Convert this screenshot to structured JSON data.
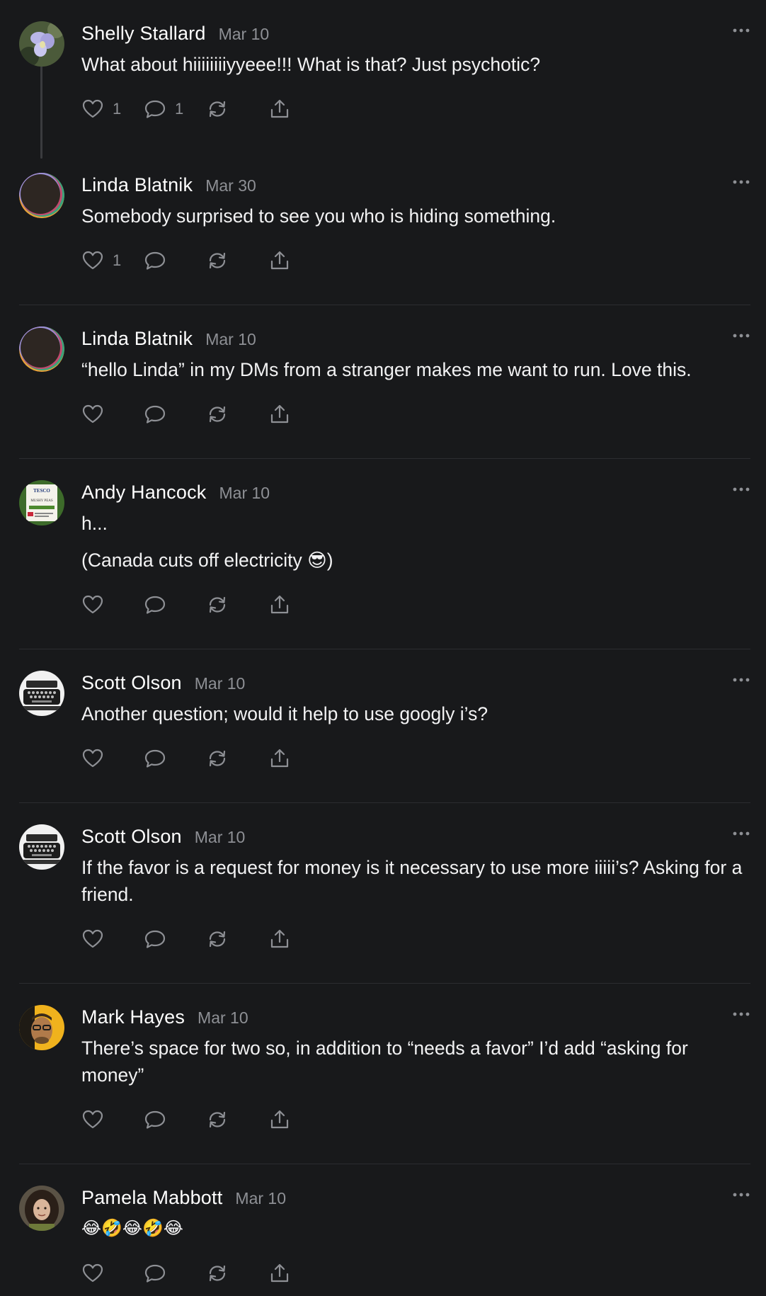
{
  "colors": {
    "background": "#18191b",
    "text": "#f2f2f3",
    "muted": "#8e9095",
    "divider": "#2c2d30"
  },
  "posts": [
    {
      "author": "Shelly Stallard",
      "date": "Mar 10",
      "lines": [
        "What about hiiiiiiiiyyeee!!! What is that? Just psychotic?"
      ],
      "likes": "1",
      "replies": "1",
      "avatar": "iris-flower-photo"
    },
    {
      "author": "Linda Blatnik",
      "date": "Mar 30",
      "lines": [
        "Somebody surprised to see you who is hiding something."
      ],
      "likes": "1",
      "replies": "",
      "avatar": "crescent-ring-avatar"
    },
    {
      "author": "Linda Blatnik",
      "date": "Mar 10",
      "lines": [
        "“hello Linda” in my DMs from a stranger makes me want to run. Love this."
      ],
      "likes": "",
      "replies": "",
      "avatar": "crescent-ring-avatar"
    },
    {
      "author": "Andy Hancock",
      "date": "Mar 10",
      "lines": [
        "h...",
        "(Canada cuts off electricity 😎)"
      ],
      "likes": "",
      "replies": "",
      "avatar": "tesco-mushy-peas-label"
    },
    {
      "author": "Scott Olson",
      "date": "Mar 10",
      "lines": [
        "Another question; would it help to use googly i’s?"
      ],
      "likes": "",
      "replies": "",
      "avatar": "typewriter-photo"
    },
    {
      "author": "Scott Olson",
      "date": "Mar 10",
      "lines": [
        "If the favor is a request for money is it necessary to use more iiiii’s? Asking for a friend."
      ],
      "likes": "",
      "replies": "",
      "avatar": "typewriter-photo"
    },
    {
      "author": "Mark Hayes",
      "date": "Mar 10",
      "lines": [
        "There’s space for two so, in addition to “needs a favor” I’d add “asking for money”"
      ],
      "likes": "",
      "replies": "",
      "avatar": "man-glasses-yellow-photo"
    },
    {
      "author": "Pamela Mabbott",
      "date": "Mar 10",
      "lines": [
        "😂🤣😂🤣😂"
      ],
      "likes": "",
      "replies": "",
      "avatar": "woman-curly-hair-photo"
    }
  ],
  "avatar_text": {
    "tesco": "TESCO",
    "peas": "MUSHY PEAS"
  }
}
